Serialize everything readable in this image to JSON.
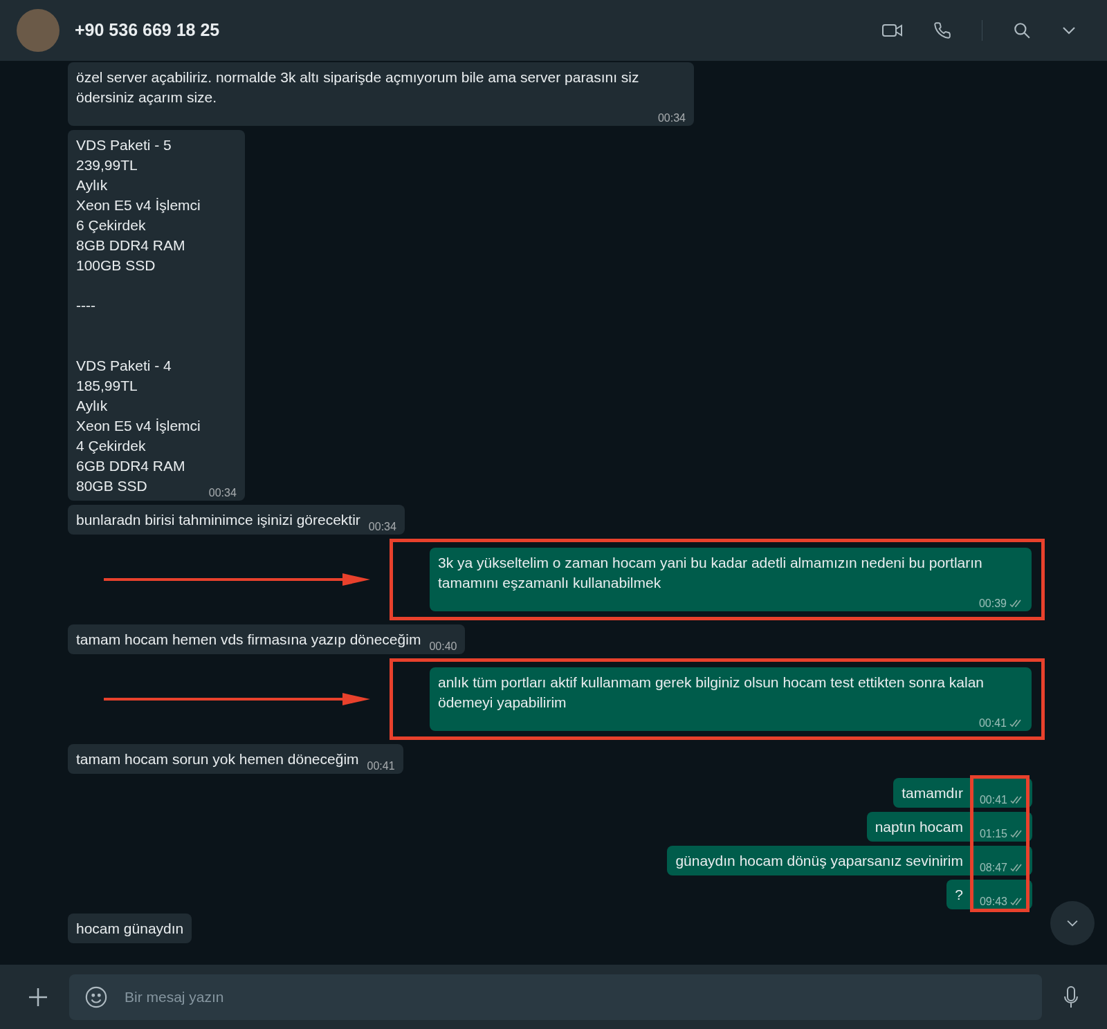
{
  "header": {
    "contact": "+90 536 669 18 25"
  },
  "messages": [
    {
      "kind": "incoming",
      "text": "özel server açabiliriz. normalde 3k altı siparişde açmıyorum bile ama server parasını siz ödersiniz açarım size.",
      "time": "00:34",
      "boxed": false,
      "time_marked": false
    },
    {
      "kind": "incoming",
      "text": "VDS Paketi - 5\n239,99TL\nAylık\nXeon E5 v4 İşlemci\n6 Çekirdek\n8GB DDR4 RAM\n100GB SSD\n\n----\n\n\nVDS Paketi - 4\n185,99TL\nAylık\nXeon E5 v4 İşlemci\n4 Çekirdek\n6GB DDR4 RAM\n80GB SSD",
      "time": "00:34",
      "boxed": false,
      "time_marked": false
    },
    {
      "kind": "incoming",
      "text": "bunlaradn birisi tahminimce işinizi görecektir",
      "time": "00:34",
      "boxed": false,
      "time_marked": false
    },
    {
      "kind": "outgoing",
      "text": "3k ya yükseltelim o zaman hocam yani bu kadar adetli almamızın nedeni bu portların tamamını eşzamanlı kullanabilmek",
      "time": "00:39",
      "read": false,
      "boxed": true,
      "time_marked": false
    },
    {
      "kind": "incoming",
      "text": "tamam hocam hemen vds firmasına yazıp döneceğim",
      "time": "00:40",
      "boxed": false,
      "time_marked": false
    },
    {
      "kind": "outgoing",
      "text": "anlık tüm portları aktif kullanmam gerek bilginiz olsun hocam test ettikten sonra kalan ödemeyi yapabilirim",
      "time": "00:41",
      "read": false,
      "boxed": true,
      "time_marked": false
    },
    {
      "kind": "incoming",
      "text": "tamam hocam sorun yok hemen döneceğim",
      "time": "00:41",
      "boxed": false,
      "time_marked": false
    },
    {
      "kind": "outgoing",
      "text": "tamamdır",
      "time": "00:41",
      "read": false,
      "boxed": false,
      "time_marked": true
    },
    {
      "kind": "outgoing",
      "text": "naptın hocam",
      "time": "01:15",
      "read": false,
      "boxed": false,
      "time_marked": true
    },
    {
      "kind": "outgoing",
      "text": "günaydın hocam dönüş yaparsanız sevinirim",
      "time": "08:47",
      "read": false,
      "boxed": false,
      "time_marked": true
    },
    {
      "kind": "outgoing",
      "text": "?",
      "time": "09:43",
      "read": false,
      "boxed": false,
      "time_marked": true
    },
    {
      "kind": "incoming",
      "text": "hocam günaydın",
      "boxed": false,
      "time_marked": false
    }
  ],
  "composer": {
    "placeholder": "Bir mesaj yazın"
  }
}
